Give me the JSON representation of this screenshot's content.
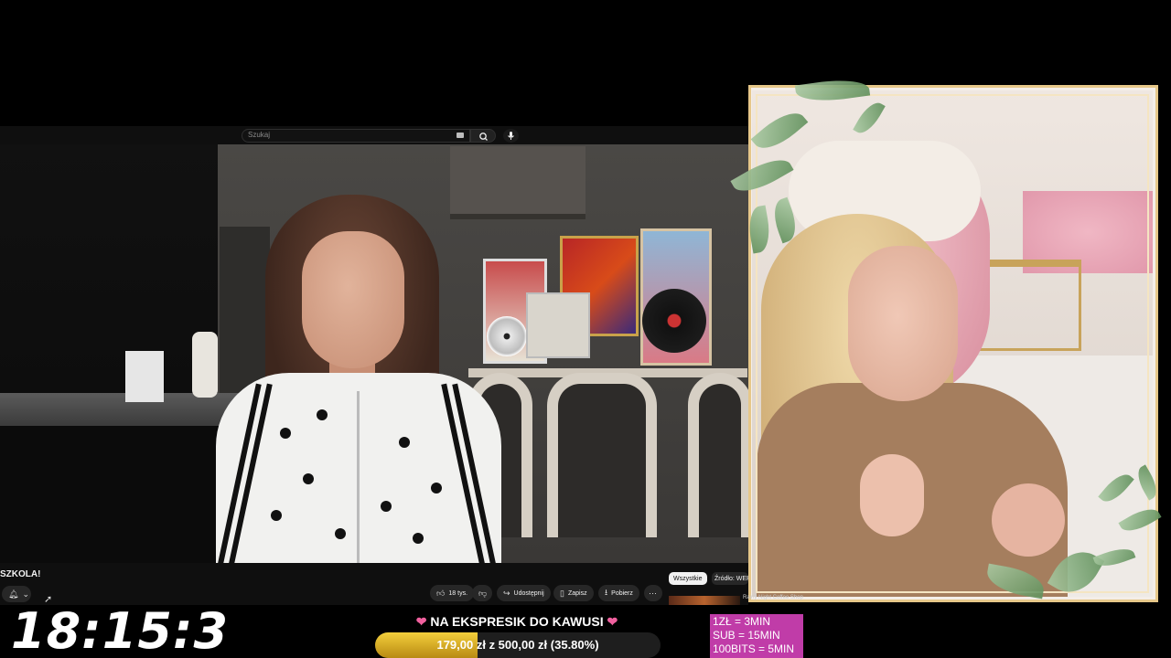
{
  "youtube": {
    "search_placeholder": "Szukaj",
    "video_title_fragment": "SZKOLA!",
    "actions": {
      "likes": "18 tys.",
      "share": "Udostępnij",
      "save": "Zapisz",
      "download": "Pobierz",
      "more": "⋯"
    },
    "chips": {
      "all": "Wszystkie",
      "source": "Źródło: WER"
    },
    "recommendation_title": "Rainy Night Coffee Shop"
  },
  "stream": {
    "timer": "18:15:3",
    "goal": {
      "title": "NA EKSPRESIK DO KAWUSI",
      "text": "179,00 zł  z  500,00 zł (35.80%)",
      "progress": 0.358,
      "fill_color": "#f4cf3c"
    },
    "rates": [
      "1ZŁ = 3MIN",
      "SUB = 15MIN",
      "100BITS = 5MIN"
    ],
    "rates_color": "#c03ca8"
  }
}
